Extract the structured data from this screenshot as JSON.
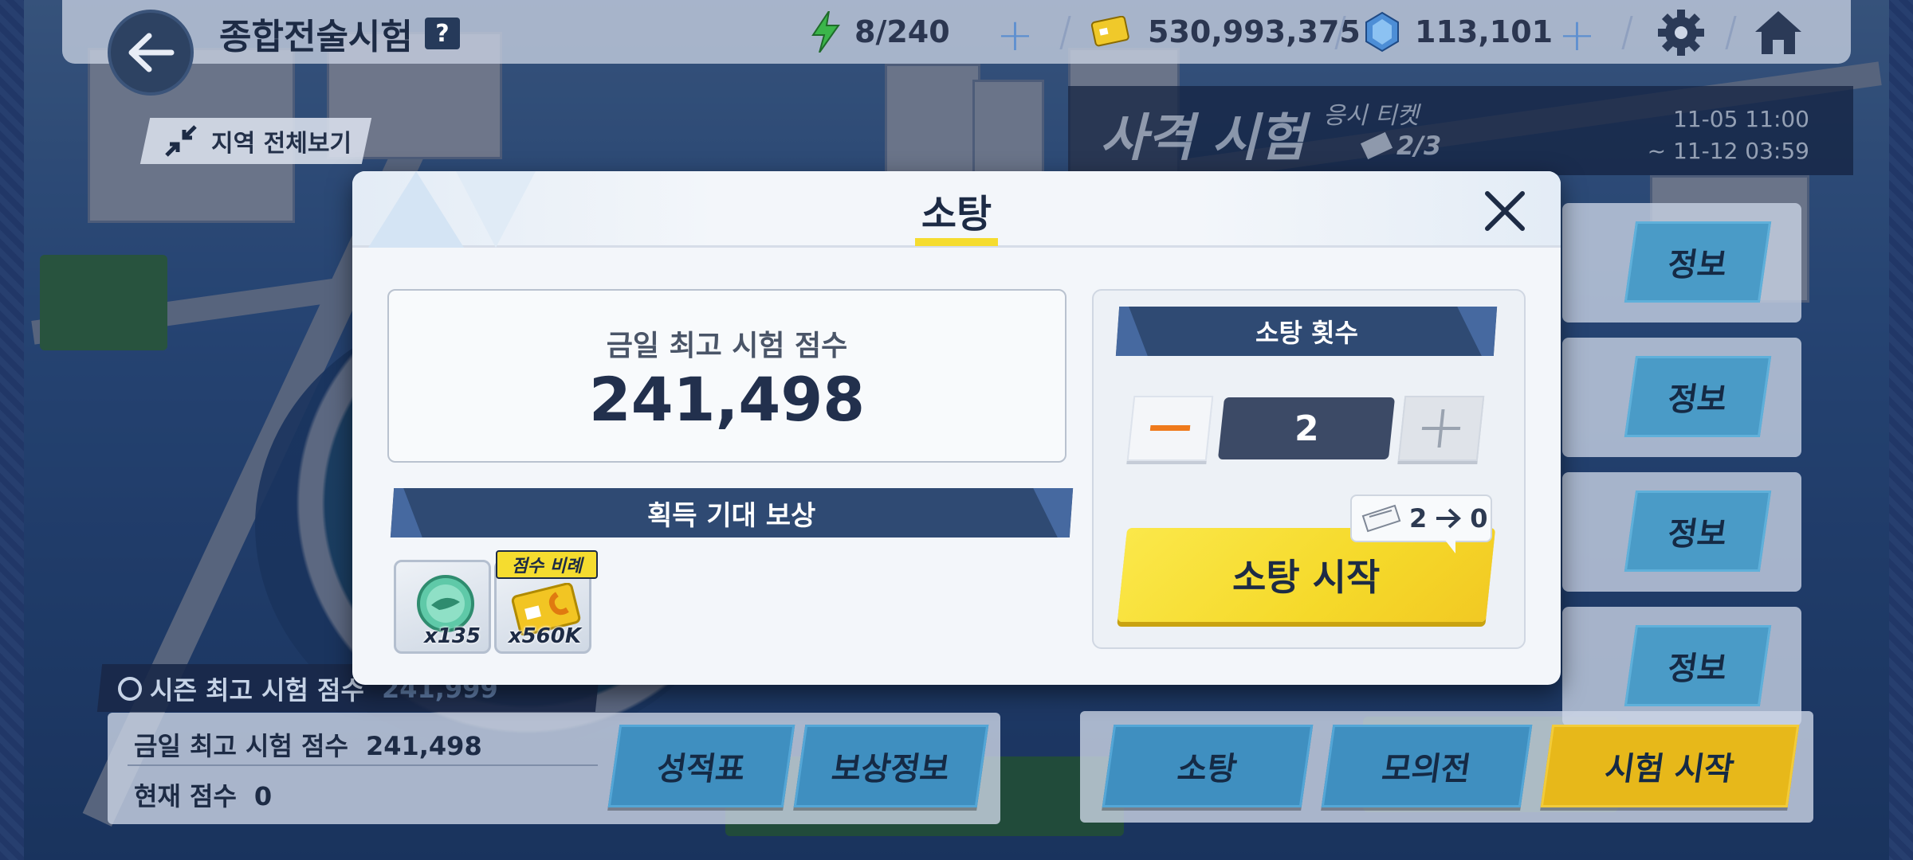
{
  "topbar": {
    "title": "종합전술시험",
    "help_icon": "?",
    "stamina": "8/240",
    "credits": "530,993,375",
    "gems": "113,101"
  },
  "region_view": {
    "label": "지역 전체보기"
  },
  "event": {
    "title": "사격 시험",
    "ticket_label": "응시 티켓",
    "tickets": "2/3",
    "date_start": "11-05 11:00",
    "date_end": "~ 11-12 03:59"
  },
  "info_buttons": [
    "정보",
    "정보",
    "정보",
    "정보"
  ],
  "season": {
    "label": "시즌 최고 시험 점수",
    "value": "241,999"
  },
  "stats": {
    "today_label": "금일 최고 시험 점수",
    "today_value": "241,498",
    "current_label": "현재 점수",
    "current_value": "0"
  },
  "bottom_buttons": {
    "report": "성적표",
    "reward_info": "보상정보",
    "sweep": "소탕",
    "mock": "모의전",
    "start_exam": "시험 시작"
  },
  "modal": {
    "title": "소탕",
    "score_label": "금일 최고 시험 점수",
    "score_value": "241,498",
    "reward_header": "획득 기대 보상",
    "reward_tag": "점수 비례",
    "rewards": [
      {
        "icon": "activity-report-icon",
        "qty": "x135"
      },
      {
        "icon": "credit-card-icon",
        "qty": "x560K"
      }
    ],
    "sweep_count_header": "소탕 횟수",
    "count": "2",
    "ticket_from": "2",
    "ticket_to": "0",
    "start_button": "소탕 시작"
  },
  "colors": {
    "accent_yellow": "#f5dc2f",
    "navy": "#2f4a73",
    "button_blue": "#4a9bc7"
  }
}
